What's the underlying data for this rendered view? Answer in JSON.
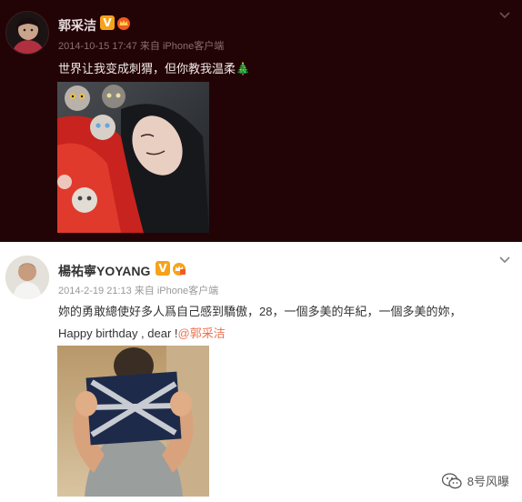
{
  "posts": [
    {
      "author": "郭采洁",
      "badges": [
        "V"
      ],
      "time": "2014-10-15 17:47",
      "source": "来自 iPhone客户端",
      "text": "世界让我变成刺猬，但你教我温柔🎄",
      "image_alt": "girl-in-red-hoodie-with-cats-photo"
    },
    {
      "author": "楊祐寧YOYANG",
      "badges": [
        "V"
      ],
      "time": "2014-2-19 21:13",
      "source": "来自 iPhone客户端",
      "text_line1": "妳的勇敢總使好多人爲自己感到驕傲，28，一個多美的年紀，一個多美的妳，",
      "text_line2_prefix": "Happy birthday , dear !",
      "mention": "@郭采洁",
      "image_alt": "man-holding-taped-paper-photo"
    }
  ],
  "watermark": {
    "account": "8号风曝"
  },
  "colors": {
    "dark_bg": "#230406",
    "badge": "#f7a21b",
    "mention": "#eb7350"
  }
}
